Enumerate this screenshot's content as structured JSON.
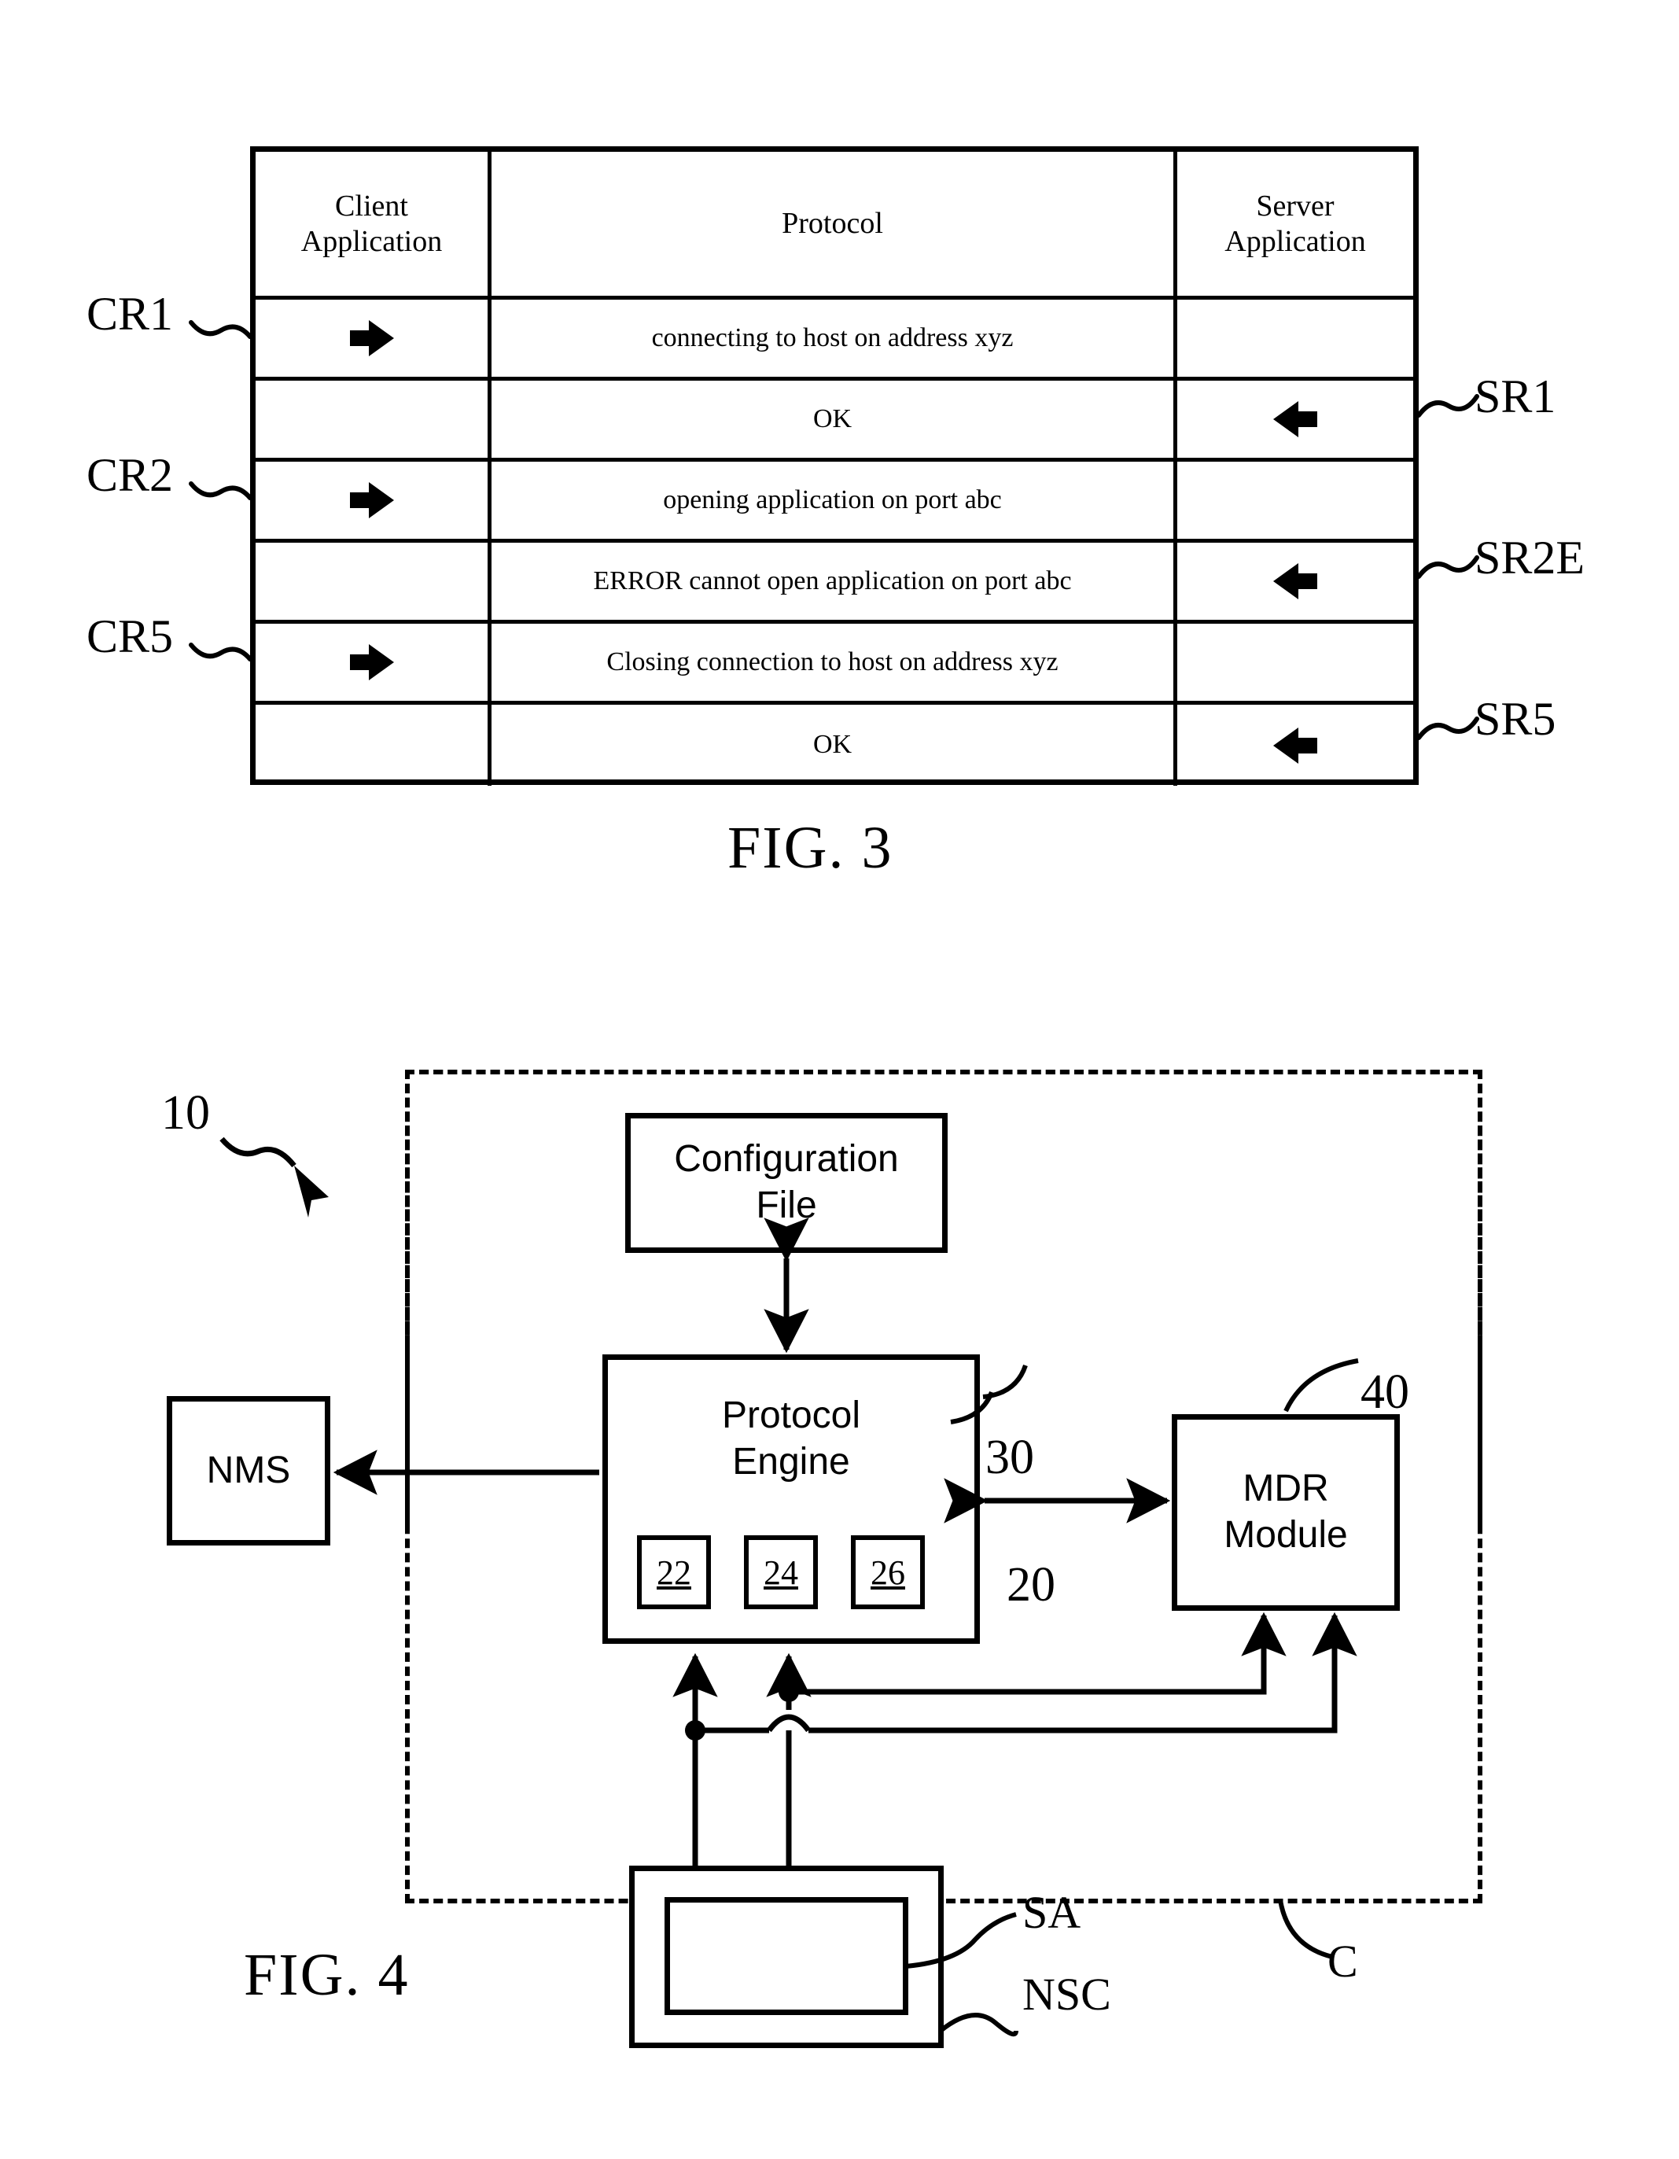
{
  "figure3": {
    "caption": "FIG. 3",
    "columns": [
      "Client\nApplication",
      "Protocol",
      "Server\nApplication"
    ],
    "col_client": "Client Application",
    "col_client_l1": "Client",
    "col_client_l2": "Application",
    "col_protocol": "Protocol",
    "col_server_l1": "Server",
    "col_server_l2": "Application",
    "rows": [
      {
        "left_label": "CR1",
        "right_label": "",
        "client_arrow": "arrow-right-icon",
        "protocol": "connecting to host on address xyz",
        "server_arrow": ""
      },
      {
        "left_label": "",
        "right_label": "SR1",
        "client_arrow": "",
        "protocol": "OK",
        "server_arrow": "arrow-left-icon"
      },
      {
        "left_label": "CR2",
        "right_label": "",
        "client_arrow": "arrow-right-icon",
        "protocol": "opening application on port abc",
        "server_arrow": ""
      },
      {
        "left_label": "",
        "right_label": "SR2E",
        "client_arrow": "",
        "protocol": "ERROR cannot open application on port abc",
        "server_arrow": "arrow-left-icon"
      },
      {
        "left_label": "CR5",
        "right_label": "",
        "client_arrow": "arrow-right-icon",
        "protocol": "Closing connection to host on address xyz",
        "server_arrow": ""
      },
      {
        "left_label": "",
        "right_label": "SR5",
        "client_arrow": "",
        "protocol": "OK",
        "server_arrow": "arrow-left-icon"
      }
    ]
  },
  "figure4": {
    "caption": "FIG. 4",
    "system_ref": "10",
    "boundary_ref": "C",
    "boxes": {
      "config_file_l1": "Configuration",
      "config_file_l2": "File",
      "config_file_ref": "30",
      "protocol_engine_l1": "Protocol",
      "protocol_engine_l2": "Engine",
      "protocol_engine_ref": "20",
      "nms": "NMS",
      "mdr_l1": "MDR",
      "mdr_l2": "Module",
      "mdr_ref": "40",
      "sub_modules": [
        "22",
        "24",
        "26"
      ],
      "sa_ref": "SA",
      "nsc_ref": "NSC"
    }
  }
}
